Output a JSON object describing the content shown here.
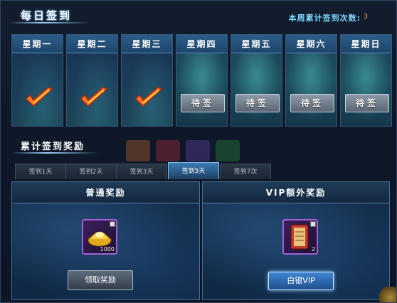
{
  "header": {
    "title": "每日签到",
    "week_count_label": "本周累计签到次数:",
    "week_count_value": "3"
  },
  "days": [
    {
      "label": "星期一",
      "status": "signed"
    },
    {
      "label": "星期二",
      "status": "signed"
    },
    {
      "label": "星期三",
      "status": "signed"
    },
    {
      "label": "星期四",
      "status": "pending",
      "button": "待签"
    },
    {
      "label": "星期五",
      "status": "pending",
      "button": "待签"
    },
    {
      "label": "星期六",
      "status": "pending",
      "button": "待签"
    },
    {
      "label": "星期日",
      "status": "pending",
      "button": "待签"
    }
  ],
  "cumulative": {
    "title": "累计签到奖励",
    "tabs": [
      {
        "label": "签到1天",
        "active": false
      },
      {
        "label": "签到2天",
        "active": false
      },
      {
        "label": "签到3天",
        "active": false
      },
      {
        "label": "签到5天",
        "active": true
      },
      {
        "label": "签到7次",
        "active": false
      }
    ]
  },
  "normal_reward": {
    "title": "普通奖励",
    "item_icon": "gold-ingot-icon",
    "item_count": "1000",
    "button": "领取奖励"
  },
  "vip_reward": {
    "title": "VIP额外奖励",
    "item_icon": "scroll-icon",
    "item_count": "2",
    "button": "白银VIP"
  },
  "colors": {
    "accent_blue": "#7fd7ff",
    "count_orange": "#ff9e3a",
    "item_border_purple": "#a35fd6"
  }
}
